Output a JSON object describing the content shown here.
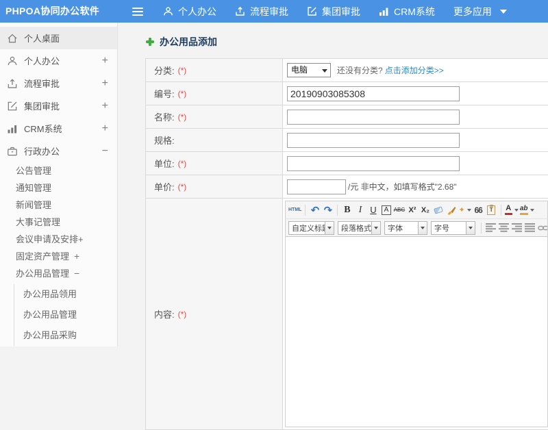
{
  "topbar": {
    "logo": "PHPOA协同办公软件",
    "menu": [
      {
        "label": "个人办公",
        "icon": "user-icon"
      },
      {
        "label": "流程审批",
        "icon": "upload-icon"
      },
      {
        "label": "集团审批",
        "icon": "edit-square-icon"
      },
      {
        "label": "CRM系统",
        "icon": "bar-chart-icon"
      },
      {
        "label": "更多应用",
        "icon": "caret-down-icon"
      }
    ]
  },
  "sidebar": {
    "items": [
      {
        "label": "个人桌面",
        "icon": "home-icon",
        "active": true
      },
      {
        "label": "个人办公",
        "icon": "user-icon",
        "toggle": "+"
      },
      {
        "label": "流程审批",
        "icon": "upload-icon",
        "toggle": "+"
      },
      {
        "label": "集团审批",
        "icon": "edit-square-icon",
        "toggle": "+"
      },
      {
        "label": "CRM系统",
        "icon": "bar-chart-icon",
        "toggle": "+"
      },
      {
        "label": "行政办公",
        "icon": "briefcase-icon",
        "toggle": "−"
      },
      {
        "label": "公告管理"
      },
      {
        "label": "通知管理"
      },
      {
        "label": "新闻管理"
      },
      {
        "label": "大事记管理"
      },
      {
        "label": "会议申请及安排+"
      },
      {
        "label": "固定资产管理",
        "toggle": "+"
      },
      {
        "label": "办公用品管理",
        "toggle": "−"
      },
      {
        "label": "办公用品领用"
      },
      {
        "label": "办公用品管理"
      },
      {
        "label": "办公用品采购"
      }
    ]
  },
  "main": {
    "title": "办公用品添加",
    "form": {
      "category_label": "分类:",
      "category_req": "(*)",
      "category_value": "电脑",
      "category_hint": "还没有分类?",
      "category_link": "点击添加分类>>",
      "code_label": "编号:",
      "code_req": "(*)",
      "code_value": "20190903085308",
      "name_label": "名称:",
      "name_req": "(*)",
      "spec_label": "规格:",
      "unit_label": "单位:",
      "unit_req": "(*)",
      "price_label": "单价:",
      "price_req": "(*)",
      "price_suffix": "/元 非中文，如填写格式\"2.68\"",
      "content_label": "内容:",
      "content_req": "(*)"
    },
    "editor": {
      "toolbar": {
        "html": "HTML",
        "undo": "↶",
        "redo": "↷",
        "bold": "B",
        "italic": "I",
        "underline": "U",
        "font_box": "A",
        "strike": "ABC",
        "superscript": "X²",
        "subscript": "X₂",
        "wand": "✦",
        "quote": "66",
        "paste": "T",
        "font_color": "A",
        "highlight": "ab"
      },
      "combos": {
        "heading": "自定义标题",
        "paragraph": "段落格式",
        "font": "字体",
        "size": "字号"
      }
    }
  },
  "colors": {
    "topbar": "#4a92e4",
    "link": "#2a8bd0",
    "title": "#1e3c5e",
    "required_star": "#e14b4b",
    "plus_icon": "#3fae41"
  }
}
